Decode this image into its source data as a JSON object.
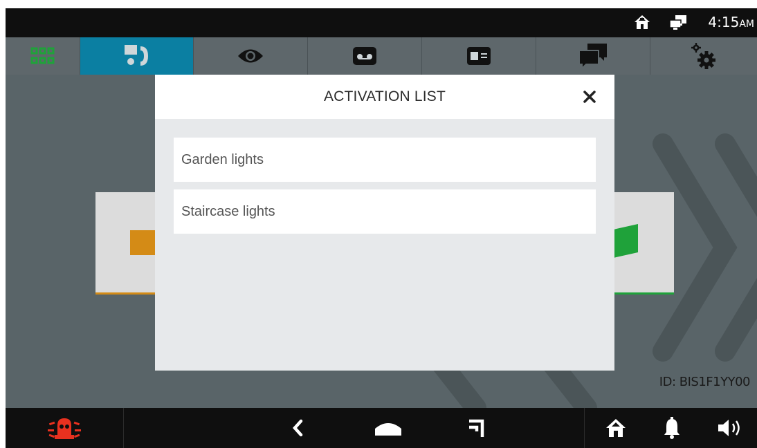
{
  "status_bar": {
    "home_icon": "home-icon",
    "network_icon": "network-icon",
    "time": "4:15",
    "ampm": "AM"
  },
  "tabs": [
    {
      "name": "apps",
      "icon": "grid-icon"
    },
    {
      "name": "intercom",
      "icon": "intercom-icon",
      "active": true
    },
    {
      "name": "view",
      "icon": "eye-icon"
    },
    {
      "name": "voicemail",
      "icon": "voicemail-icon"
    },
    {
      "name": "directory",
      "icon": "id-card-icon"
    },
    {
      "name": "messages",
      "icon": "chat-icon"
    },
    {
      "name": "settings",
      "icon": "gear-icon"
    }
  ],
  "modal": {
    "title": "ACTIVATION LIST",
    "close_icon": "close-icon",
    "items": [
      {
        "label": "Garden lights"
      },
      {
        "label": "Staircase lights"
      }
    ]
  },
  "device_id": "ID: BIS1F1YY00",
  "bottom_bar": {
    "alarm_icon": "alarm-icon",
    "back_icon": "back-icon",
    "home_nav_icon": "home-nav-icon",
    "recents_icon": "recents-icon",
    "home_icon": "home-icon",
    "bell_icon": "bell-icon",
    "volume_icon": "volume-icon"
  },
  "colors": {
    "active_tab": "#0b7fa2",
    "tab_icon_green": "#1fa23a",
    "alarm_red": "#e8311f"
  }
}
